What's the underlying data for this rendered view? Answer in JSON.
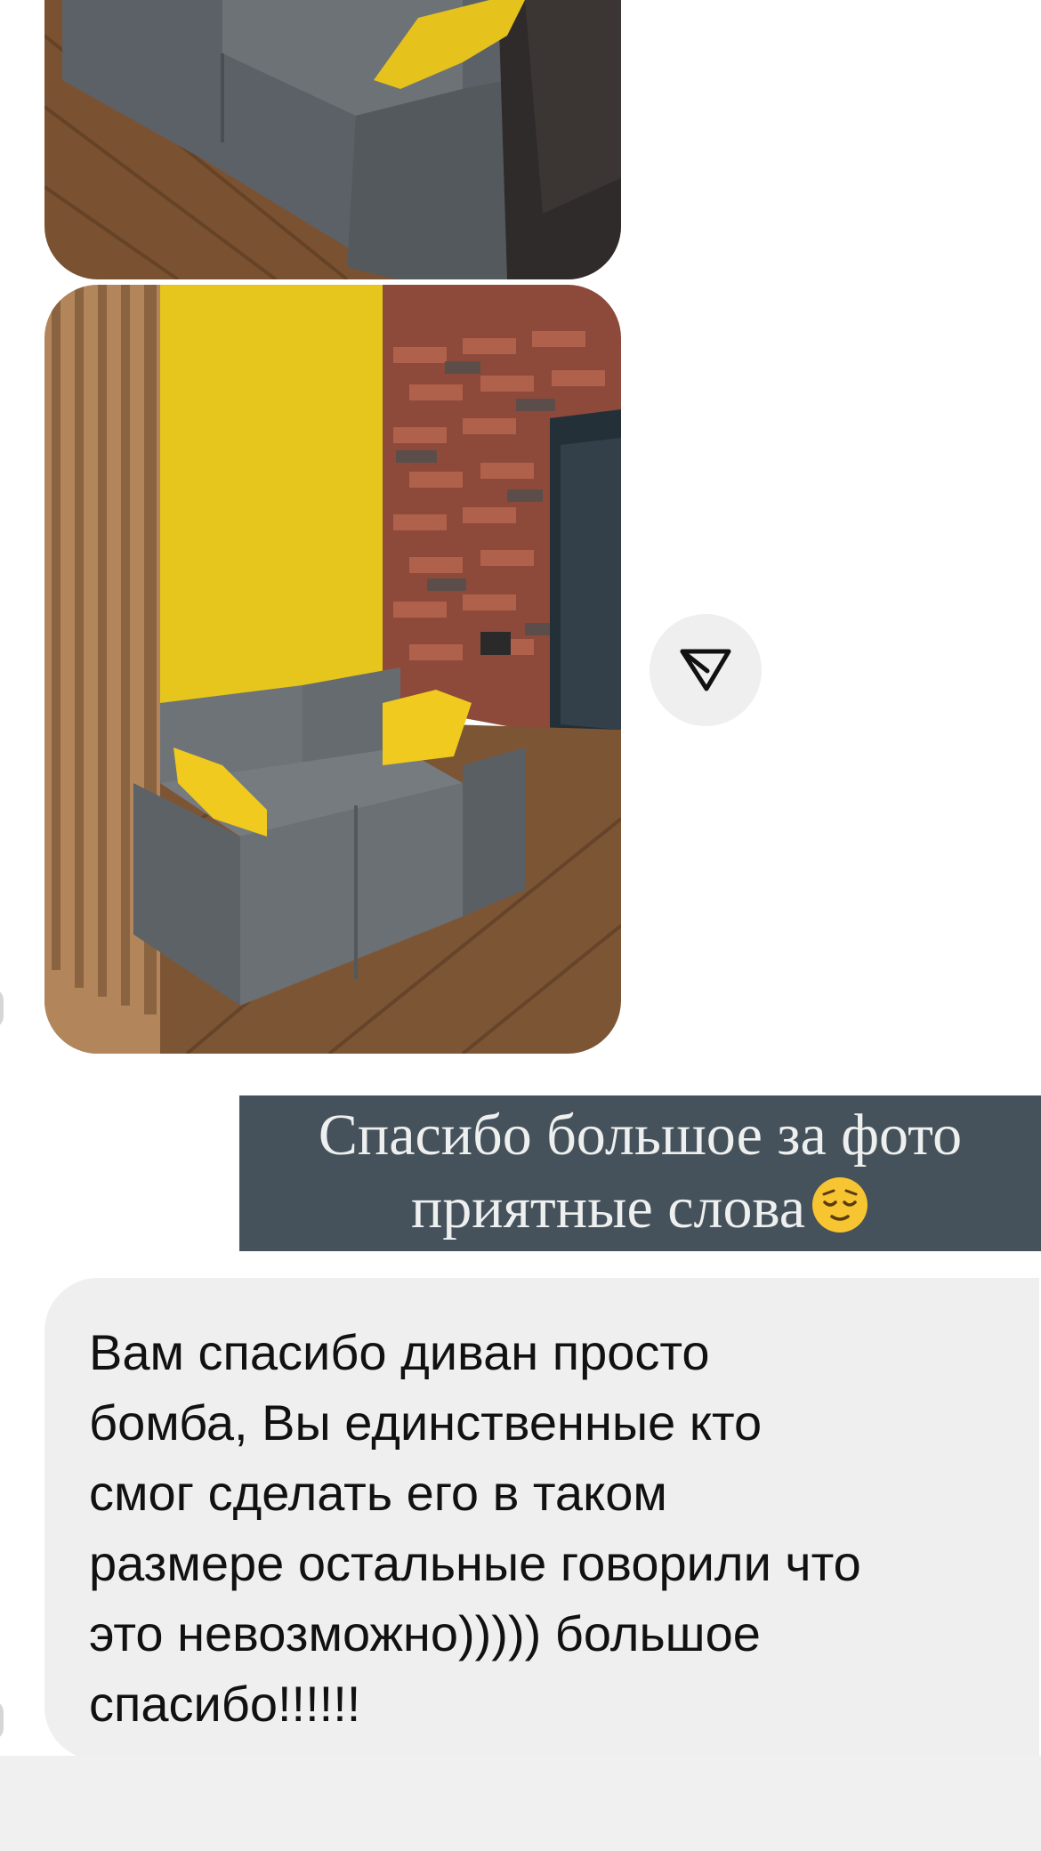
{
  "chat": {
    "photos": [
      {
        "name": "sofa-photo-cropped",
        "description_icon": "image"
      },
      {
        "name": "sofa-photo-full",
        "description_icon": "image"
      }
    ],
    "share_button": {
      "icon": "paper-plane-icon"
    },
    "reply_banner": {
      "line1": "Спасибо большое за фото",
      "line2": "приятные слова",
      "emoji": "relieved-face-emoji"
    },
    "incoming_message": {
      "text": "Вам спасибо диван просто\nбомба, Вы единственные кто\nсмог сделать его в таком\nразмере остальные говорили что\nэто невозможно))))) большое\nспасибо!!!!!!"
    }
  },
  "colors": {
    "banner_bg": "#46525b",
    "bubble_bg": "#efefef",
    "wall_yellow": "#e8c61a",
    "sofa_grey": "#6f7478"
  }
}
